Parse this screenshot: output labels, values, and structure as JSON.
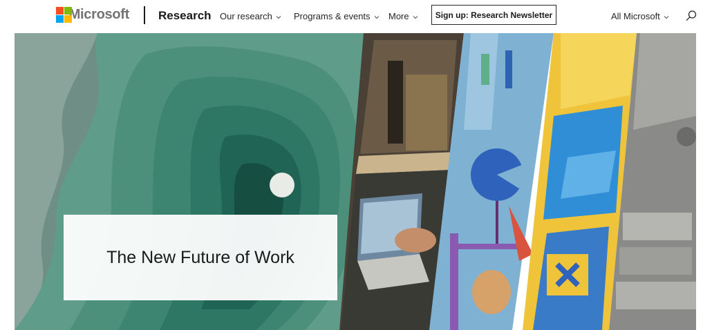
{
  "header": {
    "logo_text": "Microsoft",
    "brand": "Research",
    "nav": [
      {
        "label": "Our research"
      },
      {
        "label": "Programs & events"
      },
      {
        "label": "More"
      }
    ],
    "signup_label": "Sign up: Research Newsletter",
    "all_microsoft": "All Microsoft",
    "icons": [
      "microsoft-logo-icon",
      "chevron-down-icon",
      "search-icon"
    ]
  },
  "hero": {
    "title": "The New Future of Work"
  },
  "colors": {
    "ms_red": "#f25022",
    "ms_green": "#7fba00",
    "ms_blue": "#00a4ef",
    "ms_yellow": "#ffb900",
    "hero_teal": "#3f8a78",
    "text_dark": "#1a1a1a"
  }
}
